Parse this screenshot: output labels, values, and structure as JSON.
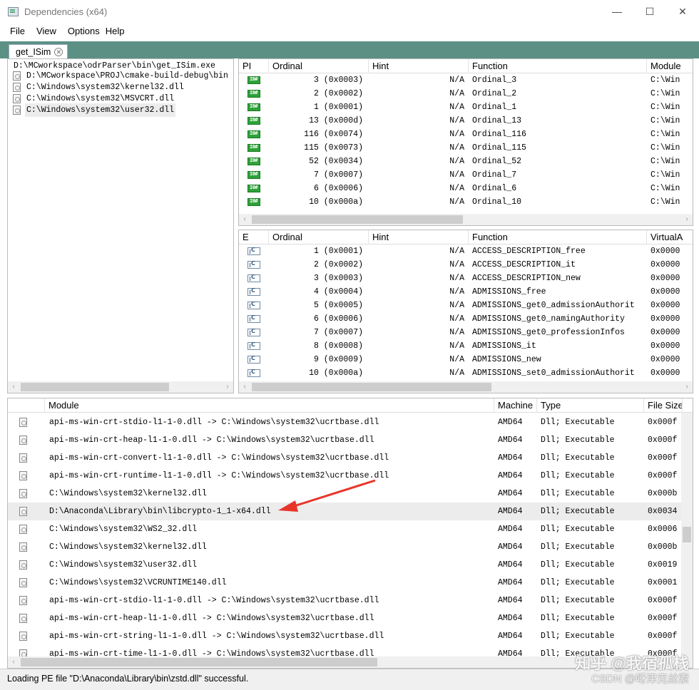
{
  "window": {
    "title": "Dependencies (x64)",
    "minimize": "—",
    "maximize": "☐",
    "close": "✕"
  },
  "menu": [
    "File",
    "View",
    "Options",
    "Help"
  ],
  "tab": {
    "label": "get_ISim",
    "close": "✕"
  },
  "tree": {
    "root": "D:\\MCworkspace\\odrParser\\bin\\get_ISim.exe",
    "children": [
      "D:\\MCworkspace\\PROJ\\cmake-build-debug\\bin",
      "C:\\Windows\\system32\\kernel32.dll",
      "C:\\Windows\\system32\\MSVCRT.dll",
      "C:\\Windows\\system32\\user32.dll"
    ]
  },
  "imports": {
    "headers": [
      "PI",
      "Ordinal",
      "Hint",
      "Function",
      "Module"
    ],
    "rows": [
      {
        "ordinal": "3 (0x0003)",
        "hint": "N/A",
        "function": "Ordinal_3",
        "module": "C:\\Win"
      },
      {
        "ordinal": "2 (0x0002)",
        "hint": "N/A",
        "function": "Ordinal_2",
        "module": "C:\\Win"
      },
      {
        "ordinal": "1 (0x0001)",
        "hint": "N/A",
        "function": "Ordinal_1",
        "module": "C:\\Win"
      },
      {
        "ordinal": "13 (0x000d)",
        "hint": "N/A",
        "function": "Ordinal_13",
        "module": "C:\\Win"
      },
      {
        "ordinal": "116 (0x0074)",
        "hint": "N/A",
        "function": "Ordinal_116",
        "module": "C:\\Win"
      },
      {
        "ordinal": "115 (0x0073)",
        "hint": "N/A",
        "function": "Ordinal_115",
        "module": "C:\\Win"
      },
      {
        "ordinal": "52 (0x0034)",
        "hint": "N/A",
        "function": "Ordinal_52",
        "module": "C:\\Win"
      },
      {
        "ordinal": "7 (0x0007)",
        "hint": "N/A",
        "function": "Ordinal_7",
        "module": "C:\\Win"
      },
      {
        "ordinal": "6 (0x0006)",
        "hint": "N/A",
        "function": "Ordinal_6",
        "module": "C:\\Win"
      },
      {
        "ordinal": "10 (0x000a)",
        "hint": "N/A",
        "function": "Ordinal_10",
        "module": "C:\\Win"
      }
    ]
  },
  "exports": {
    "headers": [
      "E",
      "Ordinal",
      "Hint",
      "Function",
      "VirtualA"
    ],
    "rows": [
      {
        "ordinal": "1 (0x0001)",
        "hint": "N/A",
        "function": "ACCESS_DESCRIPTION_free",
        "va": "0x0000"
      },
      {
        "ordinal": "2 (0x0002)",
        "hint": "N/A",
        "function": "ACCESS_DESCRIPTION_it",
        "va": "0x0000"
      },
      {
        "ordinal": "3 (0x0003)",
        "hint": "N/A",
        "function": "ACCESS_DESCRIPTION_new",
        "va": "0x0000"
      },
      {
        "ordinal": "4 (0x0004)",
        "hint": "N/A",
        "function": "ADMISSIONS_free",
        "va": "0x0000"
      },
      {
        "ordinal": "5 (0x0005)",
        "hint": "N/A",
        "function": "ADMISSIONS_get0_admissionAuthorit",
        "va": "0x0000"
      },
      {
        "ordinal": "6 (0x0006)",
        "hint": "N/A",
        "function": "ADMISSIONS_get0_namingAuthority",
        "va": "0x0000"
      },
      {
        "ordinal": "7 (0x0007)",
        "hint": "N/A",
        "function": "ADMISSIONS_get0_professionInfos",
        "va": "0x0000"
      },
      {
        "ordinal": "8 (0x0008)",
        "hint": "N/A",
        "function": "ADMISSIONS_it",
        "va": "0x0000"
      },
      {
        "ordinal": "9 (0x0009)",
        "hint": "N/A",
        "function": "ADMISSIONS_new",
        "va": "0x0000"
      },
      {
        "ordinal": "10 (0x000a)",
        "hint": "N/A",
        "function": "ADMISSIONS_set0_admissionAuthorit",
        "va": "0x0000"
      }
    ]
  },
  "modules": {
    "headers": [
      "",
      "Module",
      "Machine",
      "Type",
      "File Size"
    ],
    "rows": [
      {
        "module": "api-ms-win-crt-stdio-l1-1-0.dll -> C:\\Windows\\system32\\ucrtbase.dll",
        "machine": "AMD64",
        "type": "Dll; Executable",
        "size": "0x000f"
      },
      {
        "module": "api-ms-win-crt-heap-l1-1-0.dll -> C:\\Windows\\system32\\ucrtbase.dll",
        "machine": "AMD64",
        "type": "Dll; Executable",
        "size": "0x000f"
      },
      {
        "module": "api-ms-win-crt-convert-l1-1-0.dll -> C:\\Windows\\system32\\ucrtbase.dll",
        "machine": "AMD64",
        "type": "Dll; Executable",
        "size": "0x000f"
      },
      {
        "module": "api-ms-win-crt-runtime-l1-1-0.dll -> C:\\Windows\\system32\\ucrtbase.dll",
        "machine": "AMD64",
        "type": "Dll; Executable",
        "size": "0x000f"
      },
      {
        "module": "C:\\Windows\\system32\\kernel32.dll",
        "machine": "AMD64",
        "type": "Dll; Executable",
        "size": "0x000b"
      },
      {
        "module": "D:\\Anaconda\\Library\\bin\\libcrypto-1_1-x64.dll",
        "machine": "AMD64",
        "type": "Dll; Executable",
        "size": "0x0034"
      },
      {
        "module": "C:\\Windows\\system32\\WS2_32.dll",
        "machine": "AMD64",
        "type": "Dll; Executable",
        "size": "0x0006"
      },
      {
        "module": "C:\\Windows\\system32\\kernel32.dll",
        "machine": "AMD64",
        "type": "Dll; Executable",
        "size": "0x000b"
      },
      {
        "module": "C:\\Windows\\system32\\user32.dll",
        "machine": "AMD64",
        "type": "Dll; Executable",
        "size": "0x0019"
      },
      {
        "module": "C:\\Windows\\system32\\VCRUNTIME140.dll",
        "machine": "AMD64",
        "type": "Dll; Executable",
        "size": "0x0001"
      },
      {
        "module": "api-ms-win-crt-stdio-l1-1-0.dll -> C:\\Windows\\system32\\ucrtbase.dll",
        "machine": "AMD64",
        "type": "Dll; Executable",
        "size": "0x000f"
      },
      {
        "module": "api-ms-win-crt-heap-l1-1-0.dll -> C:\\Windows\\system32\\ucrtbase.dll",
        "machine": "AMD64",
        "type": "Dll; Executable",
        "size": "0x000f"
      },
      {
        "module": "api-ms-win-crt-string-l1-1-0.dll -> C:\\Windows\\system32\\ucrtbase.dll",
        "machine": "AMD64",
        "type": "Dll; Executable",
        "size": "0x000f"
      },
      {
        "module": "api-ms-win-crt-time-l1-1-0.dll -> C:\\Windows\\system32\\ucrtbase.dll",
        "machine": "AMD64",
        "type": "Dll; Executable",
        "size": "0x000f"
      }
    ]
  },
  "status": "Loading PE file \"D:\\Anaconda\\Library\\bin\\zstd.dll\" successful.",
  "watermark": {
    "line1": "知乎 @我宿孤栈",
    "line2": "CSDN @呀津克丝索"
  },
  "colors": {
    "tab_strip": "#5c9085",
    "import_icon": "#2ea23a",
    "arrow": "#e8352a"
  }
}
